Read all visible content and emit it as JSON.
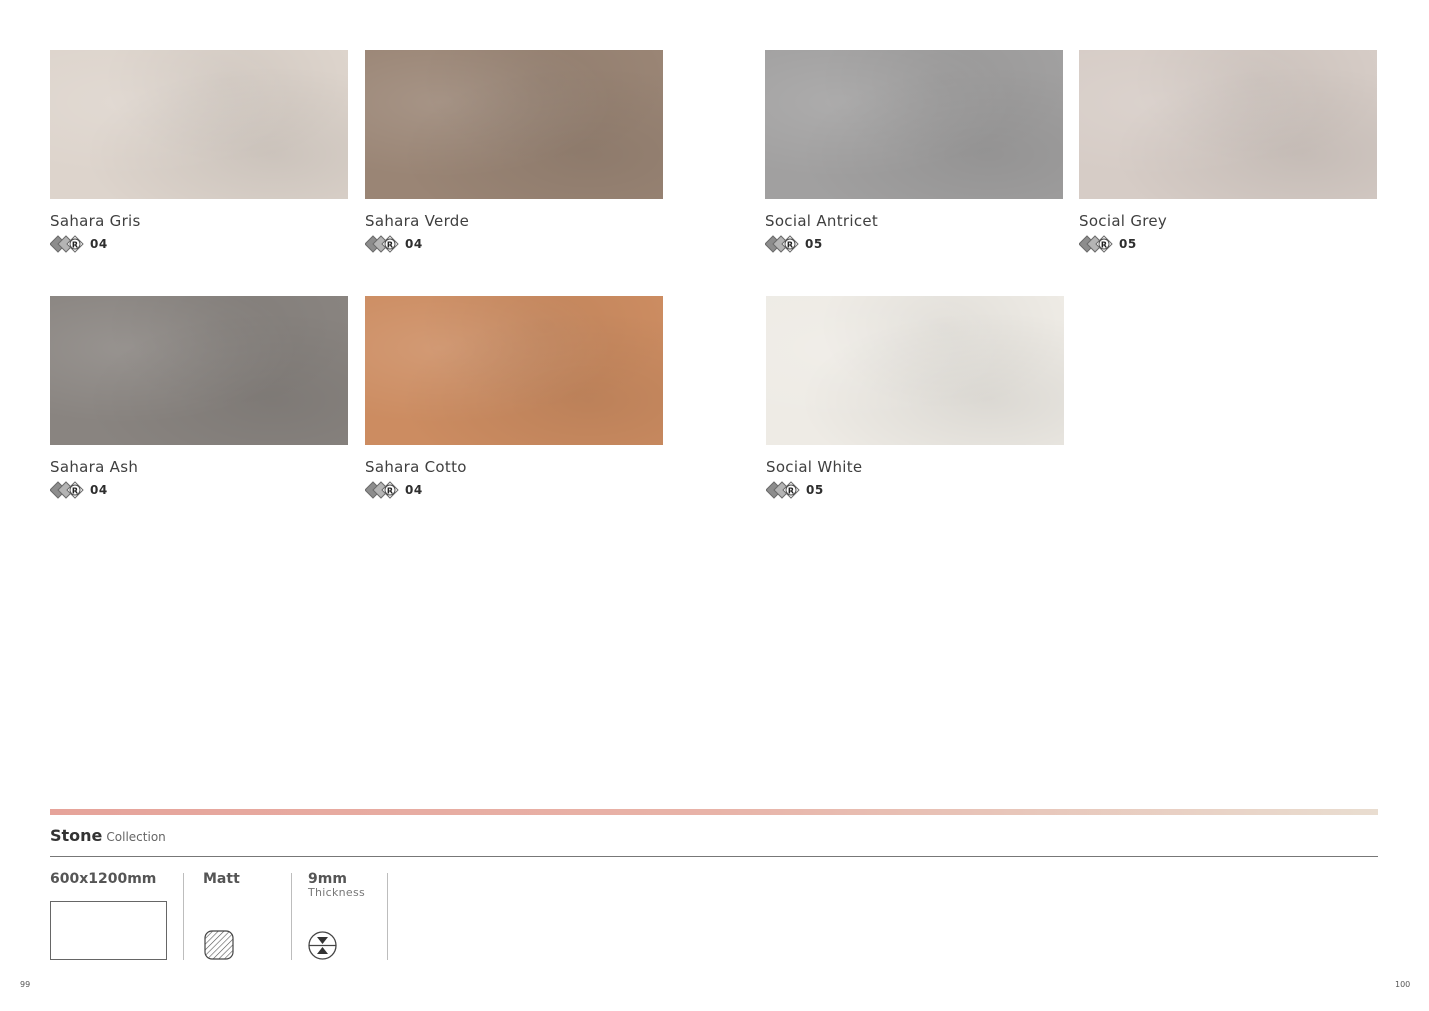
{
  "tiles": [
    {
      "name": "Sahara Gris",
      "rating": "04",
      "color": "#ddd4cc"
    },
    {
      "name": "Sahara Verde",
      "rating": "04",
      "color": "#9a8575"
    },
    {
      "name": "Social Antricet",
      "rating": "05",
      "color": "#a1a0a0"
    },
    {
      "name": "Social Grey",
      "rating": "05",
      "color": "#d6ccc6"
    },
    {
      "name": "Sahara Ash",
      "rating": "04",
      "color": "#898480"
    },
    {
      "name": "Sahara Cotto",
      "rating": "04",
      "color": "#cc8c61"
    },
    {
      "name": "Social White",
      "rating": "05",
      "color": "#eeebe5"
    }
  ],
  "rating_icon_letter": "R",
  "footer": {
    "collection_name": "Stone",
    "collection_word": "Collection",
    "size": "600x1200mm",
    "finish": "Matt",
    "thickness_value": "9mm",
    "thickness_label": "Thickness",
    "page_left": "99",
    "page_right": "100",
    "gradient_colors": [
      "#e6a39a",
      "#e9ddd0"
    ]
  }
}
